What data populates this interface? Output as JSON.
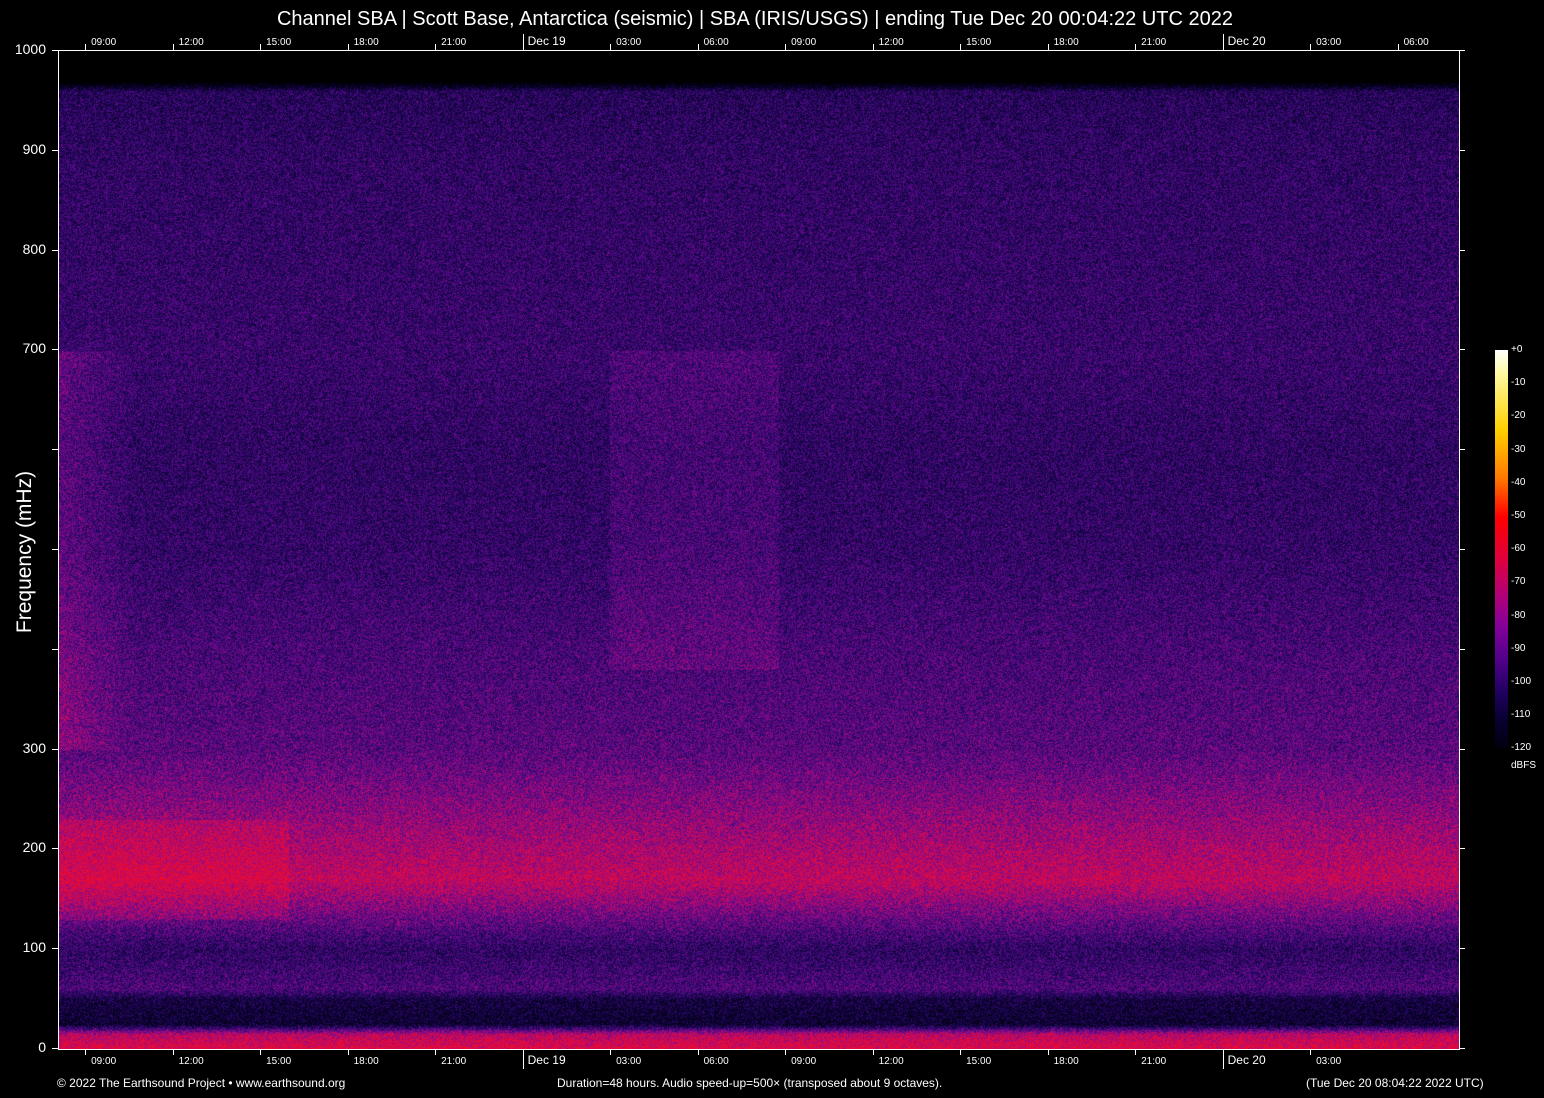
{
  "chart_data": {
    "type": "heatmap",
    "title": "Channel SBA | Scott Base, Antarctica (seismic) | SBA (IRIS/USGS) | ending Tue Dec 20 00:04:22 UTC 2022",
    "ylabel": "Frequency (mHz)",
    "ylim": [
      0,
      1000
    ],
    "y_tick_values": [
      0,
      100,
      200,
      300,
      400,
      500,
      600,
      700,
      800,
      900,
      1000
    ],
    "y_tick_labels": [
      "0",
      "100",
      "200",
      "300",
      "",
      "",
      "",
      "700",
      "800",
      "900",
      "1000"
    ],
    "x_range_hours": 48,
    "x_start_offset_hours": 0.93,
    "x_tick_spacing_hours": 3,
    "x_top_labels": [
      "09:00",
      "12:00",
      "15:00",
      "18:00",
      "21:00",
      "Dec 19",
      "03:00",
      "06:00",
      "09:00",
      "12:00",
      "15:00",
      "18:00",
      "21:00",
      "Dec 20",
      "03:00",
      "06:00"
    ],
    "x_bottom_labels": [
      "09:00",
      "12:00",
      "15:00",
      "18:00",
      "21:00",
      "Dec 19",
      "03:00",
      "06:00",
      "09:00",
      "12:00",
      "15:00",
      "18:00",
      "21:00",
      "Dec 20",
      "03:00"
    ],
    "colorbar": {
      "label": "dBFS",
      "range": [
        -120,
        0
      ],
      "tick_labels": [
        "+0",
        "-10",
        "-20",
        "-30",
        "-40",
        "-50",
        "-60",
        "-70",
        "-80",
        "-90",
        "-100",
        "-110",
        "-120"
      ]
    },
    "frequency_profile_dbfs": [
      [
        0,
        -68
      ],
      [
        15,
        -75
      ],
      [
        25,
        -108
      ],
      [
        50,
        -105
      ],
      [
        60,
        -92
      ],
      [
        100,
        -98
      ],
      [
        130,
        -88
      ],
      [
        170,
        -74
      ],
      [
        220,
        -80
      ],
      [
        300,
        -90
      ],
      [
        400,
        -93
      ],
      [
        500,
        -97
      ],
      [
        600,
        -98
      ],
      [
        700,
        -96
      ],
      [
        800,
        -97
      ],
      [
        900,
        -98
      ],
      [
        960,
        -100
      ],
      [
        970,
        -125
      ],
      [
        1000,
        -125
      ]
    ]
  },
  "footer": {
    "copyright": "© 2022 The Earthsound Project • www.earthsound.org",
    "duration": "Duration=48 hours. Audio speed-up=500× (transposed about 9 octaves).",
    "timestamp": "(Tue Dec 20 08:04:22 2022 UTC)"
  }
}
